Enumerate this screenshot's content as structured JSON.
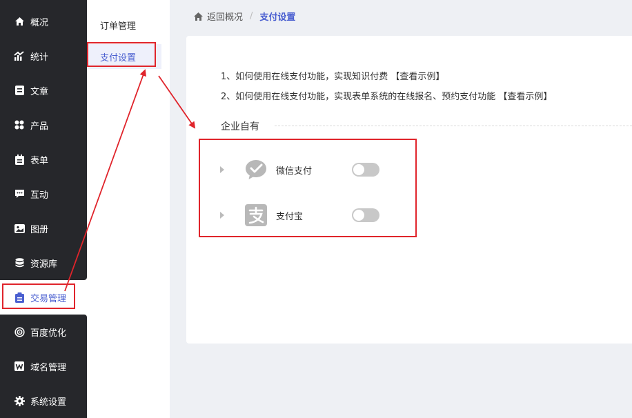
{
  "sidebar": {
    "items": [
      {
        "label": "概况",
        "icon": "home-icon"
      },
      {
        "label": "统计",
        "icon": "chart-icon"
      },
      {
        "label": "文章",
        "icon": "article-icon"
      },
      {
        "label": "产品",
        "icon": "grid-icon"
      },
      {
        "label": "表单",
        "icon": "clipboard-icon"
      },
      {
        "label": "互动",
        "icon": "chat-icon"
      },
      {
        "label": "图册",
        "icon": "album-icon"
      },
      {
        "label": "资源库",
        "icon": "database-icon"
      },
      {
        "label": "交易管理",
        "icon": "trade-icon",
        "active": true
      },
      {
        "label": "百度优化",
        "icon": "target-icon"
      },
      {
        "label": "域名管理",
        "icon": "domain-icon"
      },
      {
        "label": "系统设置",
        "icon": "gear-icon"
      }
    ]
  },
  "submenu": {
    "items": [
      {
        "label": "订单管理"
      },
      {
        "label": "支付设置",
        "active": true
      }
    ]
  },
  "breadcrumb": {
    "back": "返回概况",
    "separator": "/",
    "current": "支付设置"
  },
  "tips": [
    {
      "text": "1、如何使用在线支付功能，实现知识付费",
      "link": "【查看示例】"
    },
    {
      "text": "2、如何使用在线支付功能，实现表单系统的在线报名、预约支付功能",
      "link": "【查看示例】"
    }
  ],
  "section": {
    "title": "企业自有"
  },
  "payments": [
    {
      "name": "微信支付",
      "icon": "wechat-pay-icon",
      "enabled": false
    },
    {
      "name": "支付宝",
      "icon": "alipay-icon",
      "enabled": false
    }
  ],
  "colors": {
    "sidebar_bg": "#26272b",
    "accent": "#4a5fd0",
    "annotation_red": "#e0242b"
  }
}
